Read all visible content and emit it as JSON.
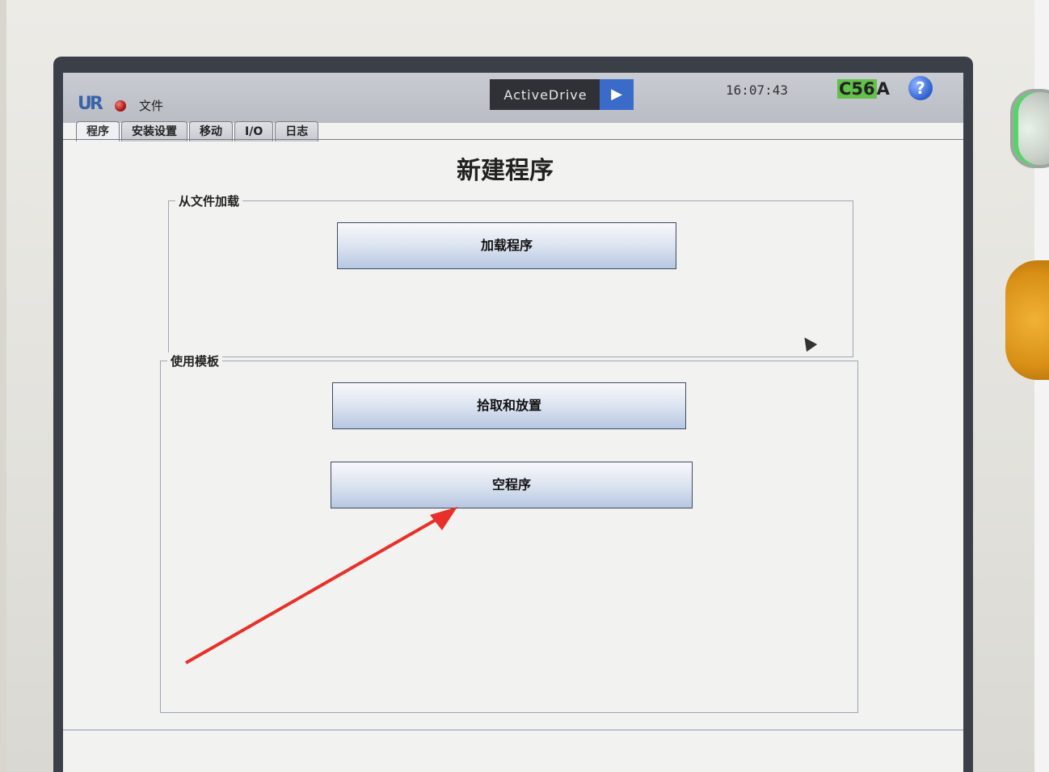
{
  "topbar": {
    "logo": "UR",
    "file_menu": "文件",
    "active_drive": "ActiveDrive",
    "play_glyph": "▶",
    "clock": "16:07:43",
    "robot_id_highlight": "C56",
    "robot_id_rest": "A",
    "help_glyph": "?"
  },
  "tabs": [
    "程序",
    "安装设置",
    "移动",
    "I/O",
    "日志"
  ],
  "active_tab": "程序",
  "page": {
    "title": "新建程序",
    "load_group": {
      "label": "从文件加载",
      "button": "加载程序"
    },
    "template_group": {
      "label": "使用模板",
      "buttons": [
        "拾取和放置",
        "空程序"
      ]
    }
  },
  "colors": {
    "screen_bg": "#f2f2f0",
    "topbar_bg": "#b9bcc3",
    "active_drive_bg": "#2f3136",
    "play_bg": "#3a6bc8",
    "robot_id_highlight": "#61c14a",
    "annotation_arrow": "#e8302a"
  },
  "icons": {
    "status": "red-status-dot-icon",
    "help": "help-icon",
    "play": "play-icon",
    "cursor": "mouse-cursor-icon"
  }
}
